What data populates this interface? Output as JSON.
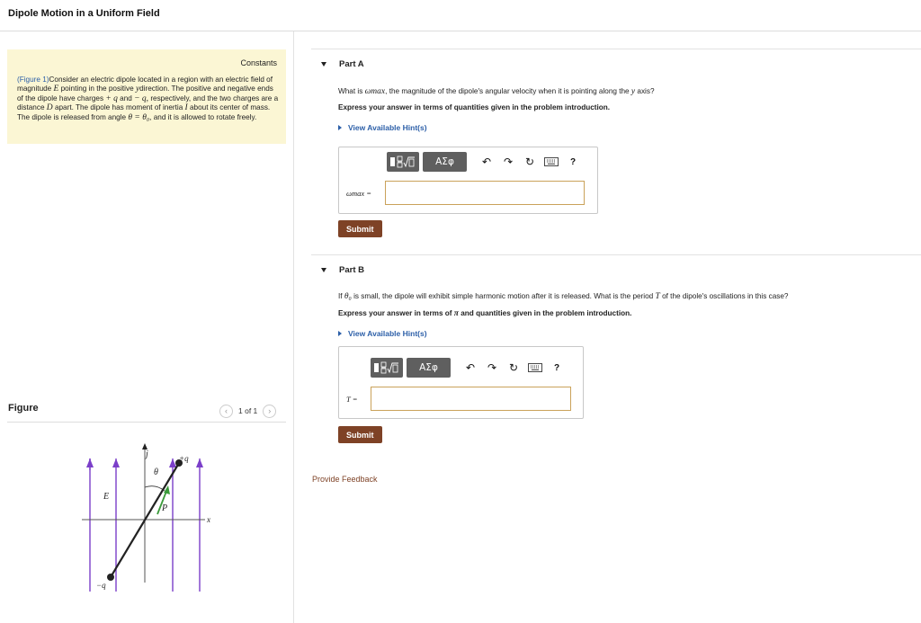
{
  "page": {
    "title": "Dipole Motion in a Uniform Field"
  },
  "constants": {
    "label": "Constants",
    "figure_link": "(Figure 1)",
    "intro_lines": [
      "Consider an electric dipole located in a region with an",
      "electric field of magnitude",
      "pointing in the positive",
      "direction. The",
      "positive and negative ends of the dipole have charges",
      "and",
      "respectively, and the two charges are a distance",
      "apart. The dipole",
      "has moment of inertia",
      "about its center of mass. The dipole is",
      "released from angle",
      ", and it is allowed to rotate freely."
    ],
    "symbols": {
      "E": "E",
      "y": "y",
      "plus_q": "+ q",
      "minus_q": "− q,",
      "D": "D",
      "I": "I",
      "theta_eq": "θ = θ₀"
    }
  },
  "figure": {
    "label": "Figure",
    "pager_text": "1 of 1",
    "prev_icon": "chevron-left-icon",
    "next_icon": "chevron-right-icon",
    "labels": {
      "j_hat": "j",
      "theta": "θ",
      "plus_q": "+q",
      "minus_q": "−q",
      "E_vec": "E",
      "P_vec": "P",
      "x_axis": "x"
    },
    "colors": {
      "field_lines": "#7b3fc9",
      "dipole_moment": "#3a9a3a",
      "dipole_rod": "#222222"
    }
  },
  "part_a": {
    "title": "Part A",
    "question_pre": "What is",
    "question_symbol": "ωmax",
    "question_post": ", the magnitude of the dipole's angular velocity when it is pointing along the",
    "question_axis": "y",
    "question_end": "axis?",
    "instruction": "Express your answer in terms of quantities given in the problem introduction.",
    "hint_label": "View Available Hint(s)",
    "variable_label": "ωmax =",
    "toolbar": {
      "greek_label": "ΑΣφ",
      "help_label": "?"
    },
    "submit_label": "Submit"
  },
  "part_b": {
    "title": "Part B",
    "question_pre": "If",
    "question_symbol": "θ₀",
    "question_post": "is small, the dipole will exhibit simple harmonic motion after it is released. What is the period",
    "question_T": "T",
    "question_end": "of the dipole's oscillations in this case?",
    "instruction_pre": "Express your answer in terms of",
    "instruction_pi": "π",
    "instruction_post": "and quantities given in the problem introduction.",
    "hint_label": "View Available Hint(s)",
    "variable_label": "T =",
    "toolbar": {
      "greek_label": "ΑΣφ",
      "help_label": "?"
    },
    "submit_label": "Submit"
  },
  "footer": {
    "feedback_label": "Provide Feedback"
  },
  "colors": {
    "submit_bg": "#7e4226",
    "link": "#2c5fa8",
    "constants_bg": "#fbf6d4",
    "input_border": "#caa25a"
  }
}
